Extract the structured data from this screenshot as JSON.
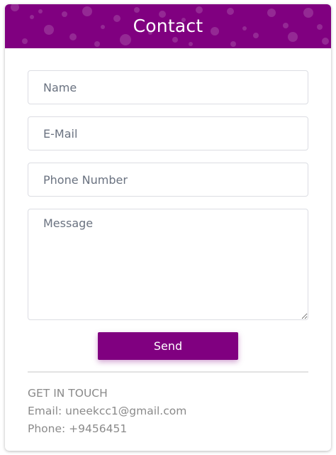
{
  "header": {
    "title": "Contact"
  },
  "form": {
    "name_placeholder": "Name",
    "email_placeholder": "E-Mail",
    "phone_placeholder": "Phone Number",
    "message_placeholder": "Message",
    "send_label": "Send"
  },
  "info": {
    "heading": "GET IN TOUCH",
    "email_line": "Email: uneekcc1@gmail.com",
    "phone_line": "Phone: +9456451"
  },
  "colors": {
    "accent": "#800080",
    "info_text": "#8a8a8a",
    "border": "#dcdde3"
  }
}
